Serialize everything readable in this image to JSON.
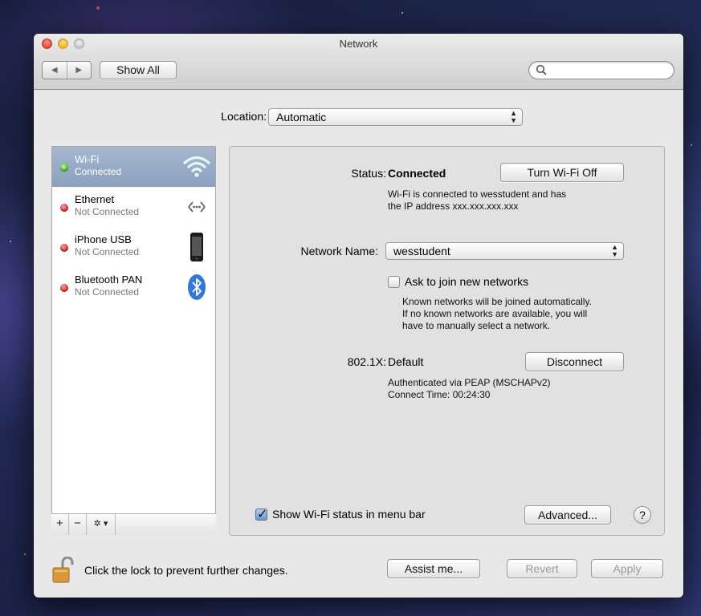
{
  "window": {
    "title": "Network"
  },
  "toolbar": {
    "back_icon": "◀",
    "forward_icon": "▶",
    "show_all": "Show All",
    "search_placeholder": ""
  },
  "location": {
    "label": "Location:",
    "value": "Automatic"
  },
  "services": [
    {
      "name": "Wi-Fi",
      "status": "Connected",
      "status_color": "#3fb21f",
      "icon": "wifi-icon",
      "selected": true
    },
    {
      "name": "Ethernet",
      "status": "Not Connected",
      "status_color": "#d21e1e",
      "icon": "ethernet-icon",
      "selected": false
    },
    {
      "name": "iPhone USB",
      "status": "Not Connected",
      "status_color": "#d21e1e",
      "icon": "iphone-icon",
      "selected": false
    },
    {
      "name": "Bluetooth PAN",
      "status": "Not Connected",
      "status_color": "#d21e1e",
      "icon": "bluetooth-icon",
      "selected": false
    }
  ],
  "sidebar_tools": {
    "add": "+",
    "remove": "−",
    "action": "✲ ▾"
  },
  "detail": {
    "status_label": "Status:",
    "status_value": "Connected",
    "turn_off_button": "Turn Wi-Fi Off",
    "status_desc_1": "Wi-Fi is connected to wesstudent and has",
    "status_desc_2": "the IP address xxx.xxx.xxx.xxx",
    "network_name_label": "Network Name:",
    "network_name_value": "wesstudent",
    "ask_label": "Ask to join new networks",
    "ask_desc_1": "Known networks will be joined automatically.",
    "ask_desc_2": "If no known networks are available, you will",
    "ask_desc_3": "have to manually select a network.",
    "dot1x_label": "802.1X:",
    "dot1x_value": "Default",
    "disconnect_button": "Disconnect",
    "auth_desc_1": "Authenticated via PEAP (MSCHAPv2)",
    "auth_desc_2": "Connect Time: 00:24:30",
    "show_status_label": "Show Wi-Fi status in menu bar",
    "advanced_button": "Advanced...",
    "help_button": "?"
  },
  "footer": {
    "lock_text": "Click the lock to prevent further changes.",
    "assist_button": "Assist me...",
    "revert_button": "Revert",
    "apply_button": "Apply"
  }
}
